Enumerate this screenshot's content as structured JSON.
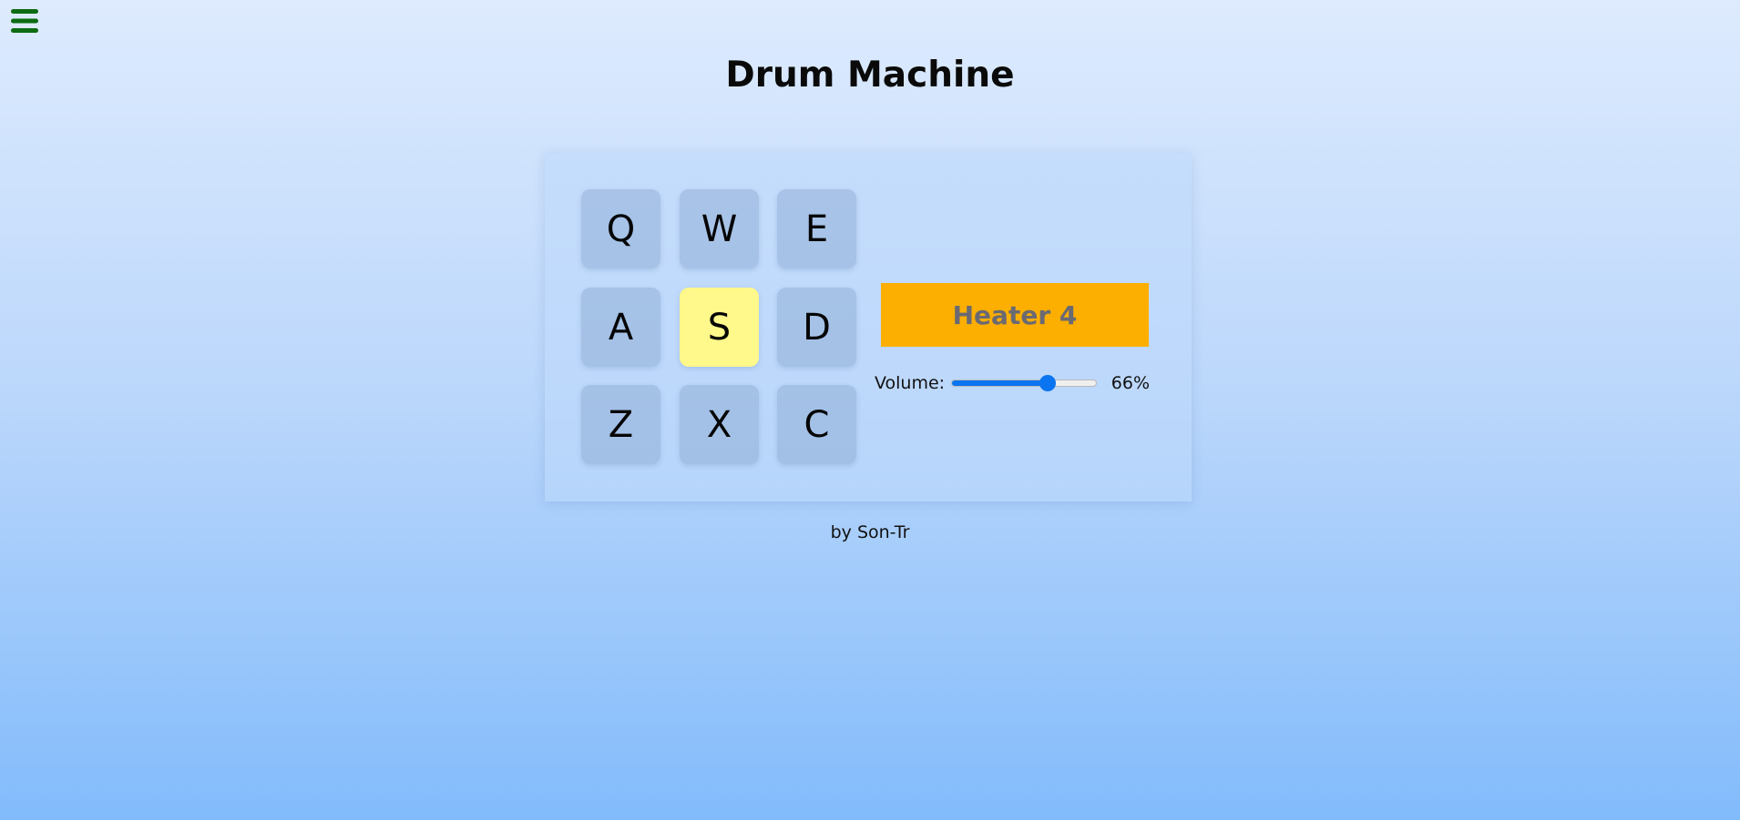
{
  "header": {
    "menu_icon": "hamburger-menu-icon",
    "title": "Drum Machine"
  },
  "pads": [
    {
      "key": "Q",
      "active": false
    },
    {
      "key": "W",
      "active": false
    },
    {
      "key": "E",
      "active": false
    },
    {
      "key": "A",
      "active": false
    },
    {
      "key": "S",
      "active": true
    },
    {
      "key": "D",
      "active": false
    },
    {
      "key": "Z",
      "active": false
    },
    {
      "key": "X",
      "active": false
    },
    {
      "key": "C",
      "active": false
    }
  ],
  "display": {
    "text": "Heater 4"
  },
  "volume": {
    "label": "Volume:",
    "value_text": "66%",
    "level": 0.66
  },
  "footer": {
    "credit": "by Son-Tr"
  },
  "colors": {
    "menu_icon": "#0d6b12",
    "active_pad": "#fff88b",
    "display_bg": "#fcaf00",
    "display_text": "#6a6a72",
    "slider_accent": "#0b74f0"
  }
}
